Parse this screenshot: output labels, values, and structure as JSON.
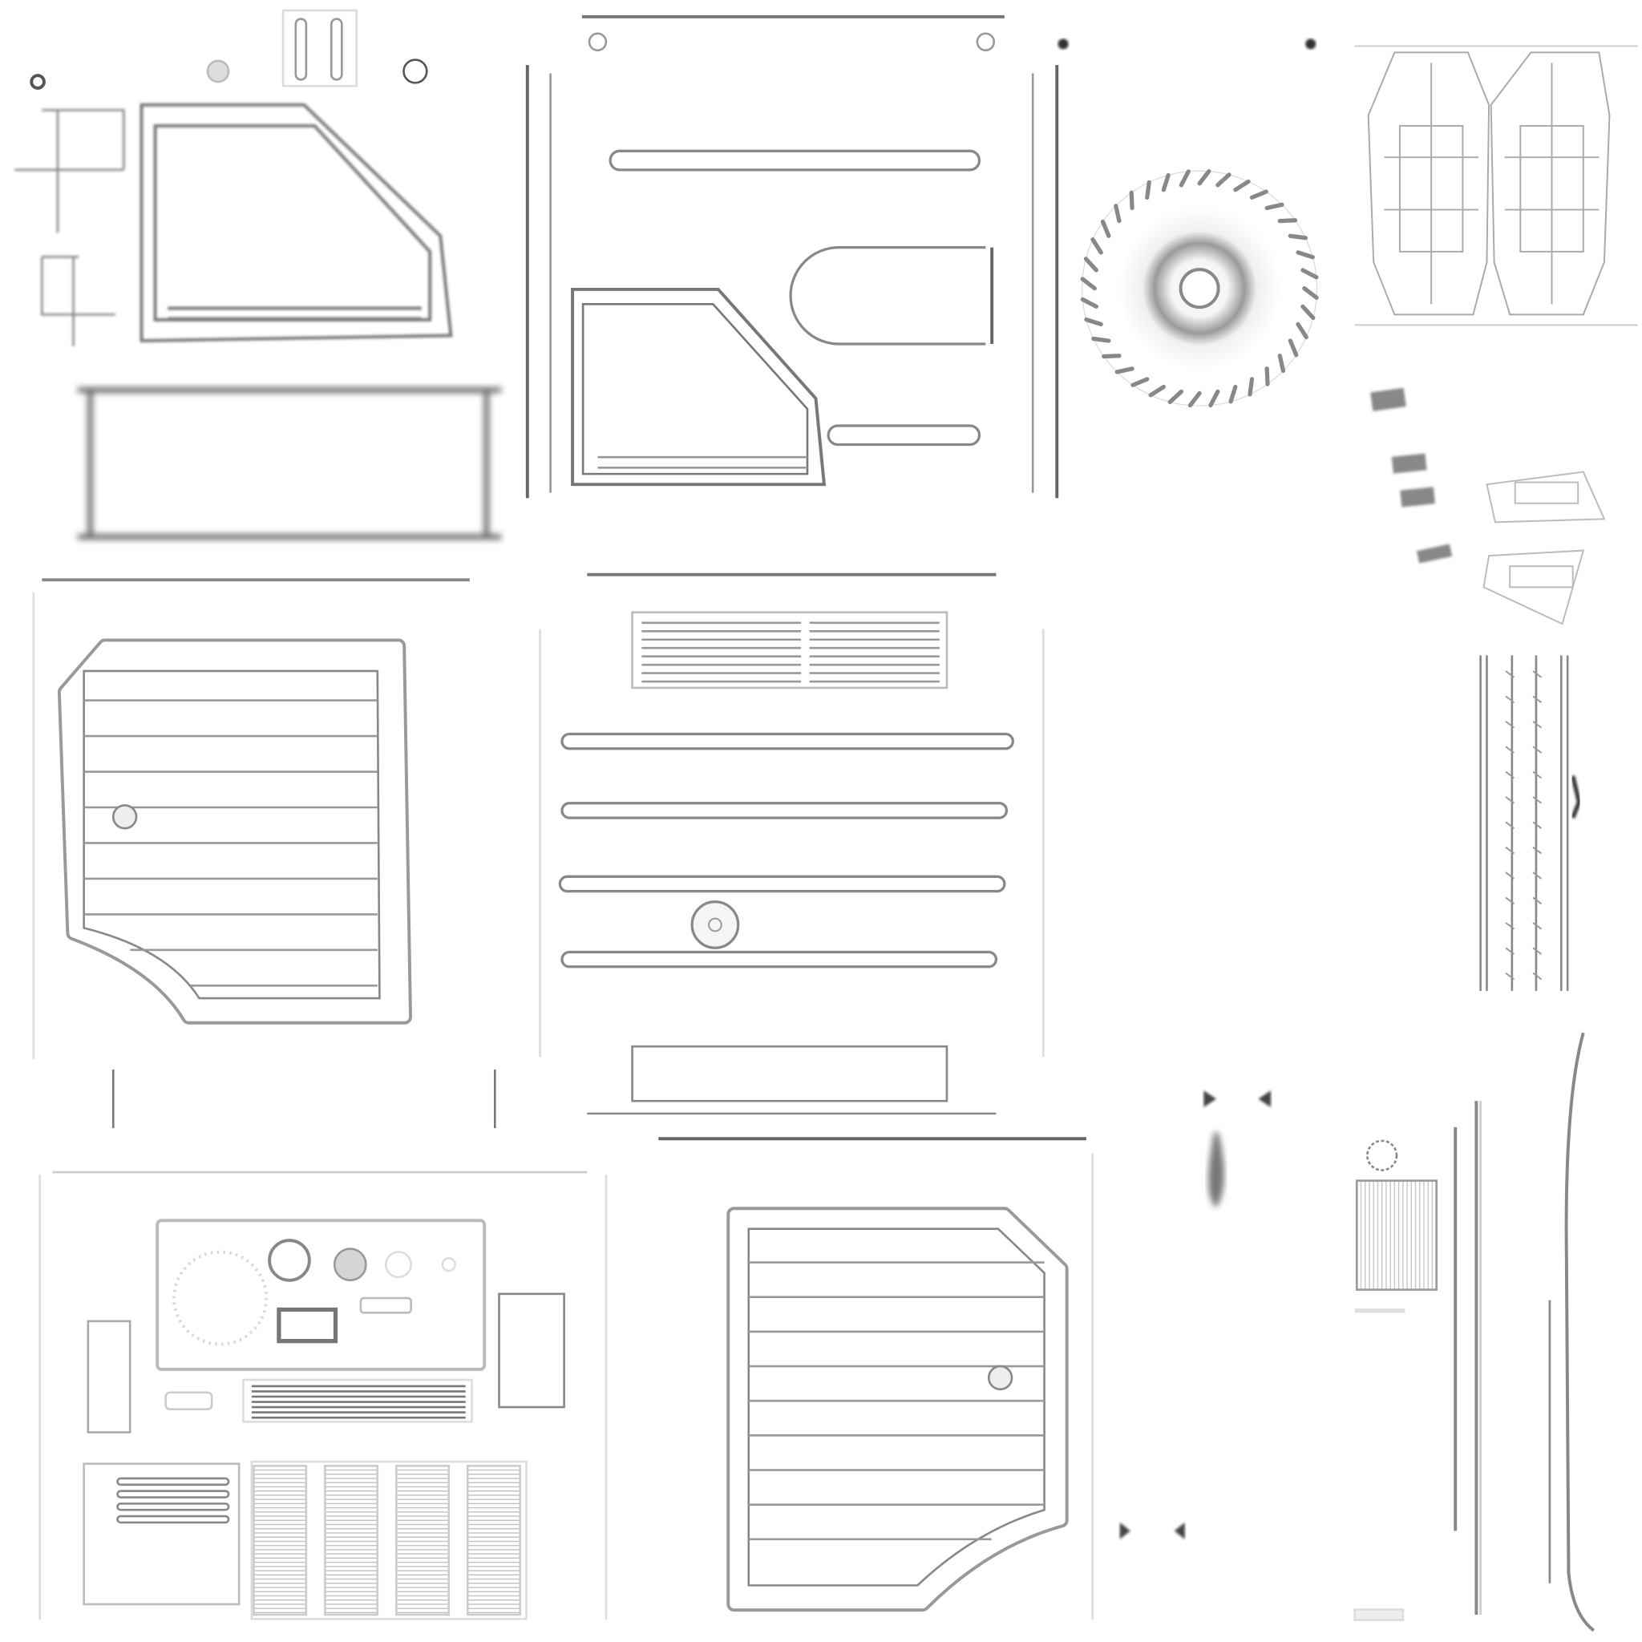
{
  "texture_atlas": {
    "background_color": "#ffffff",
    "stroke_color": "#9a9a9a",
    "dark_color": "#555555",
    "panel_fill": "#fafafa"
  }
}
